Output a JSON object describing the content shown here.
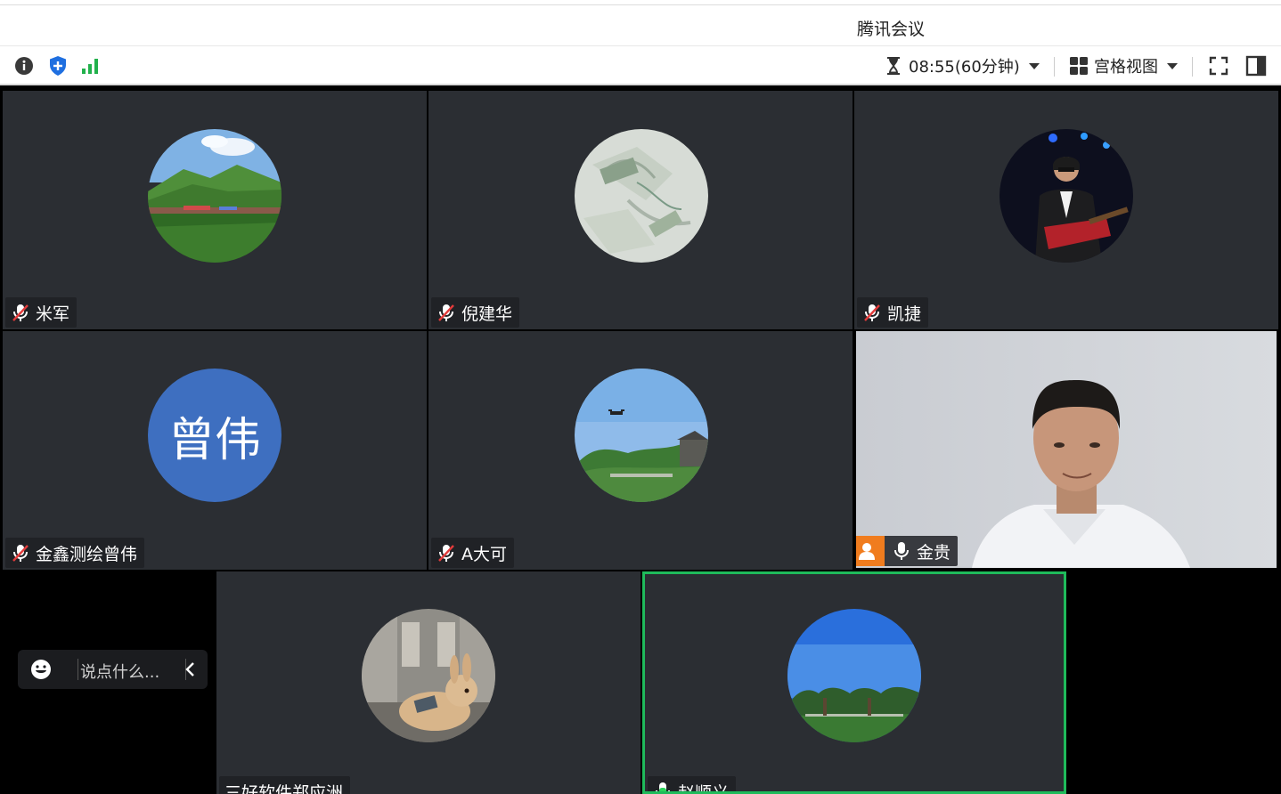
{
  "window": {
    "title": "腾讯会议"
  },
  "toolbar": {
    "timer_text": "08:55(60分钟)",
    "view_label": "宫格视图",
    "icons": [
      "info-icon",
      "security-shield-icon",
      "signal-strength-icon",
      "hourglass-icon",
      "grid-view-icon",
      "fullscreen-icon",
      "sidebar-toggle-icon"
    ]
  },
  "participants": [
    {
      "name": "米军",
      "mic": "muted",
      "avatar": "landscape-photo"
    },
    {
      "name": "倪建华",
      "mic": "muted",
      "avatar": "site-plan-photo"
    },
    {
      "name": "凯捷",
      "mic": "muted",
      "avatar": "guitarist-photo"
    },
    {
      "name": "金鑫测绘曾伟",
      "mic": "muted",
      "avatar_text": "曾伟",
      "avatar_color": "#3e6fc0"
    },
    {
      "name": "A大可",
      "mic": "muted",
      "avatar": "drone-sky-photo"
    },
    {
      "name": "金贵",
      "mic": "on",
      "host": true,
      "video": "live-camera"
    },
    {
      "name": "三好软件郑应洲",
      "avatar": "rabbit-photo"
    },
    {
      "name": "赵顺义",
      "mic": "speaking",
      "active_speaker": true,
      "avatar": "trees-sky-photo"
    }
  ],
  "chat": {
    "placeholder": "说点什么..."
  },
  "colors": {
    "active_border": "#1fbb5b",
    "host_badge": "#f07c1e",
    "tile_bg": "#2b2e33",
    "muted_red": "#e33b3b"
  }
}
